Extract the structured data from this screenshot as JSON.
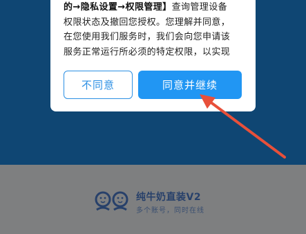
{
  "dialog": {
    "line1_bold": "的→隐私设置→权限管理】",
    "line1_rest": "查询管理设备",
    "line2": "权限状态及撤回您授权。您理解并同意，",
    "line3": "在您使用我们服务时，我们会向您申请该",
    "line4": "服务正常运行所必须的特定权限，以实现",
    "decline_label": "不同意",
    "agree_label": "同意并继续"
  },
  "brand": {
    "title": "纯牛奶直装V2",
    "subtitle": "多个账号，同时在线"
  },
  "colors": {
    "overlay_top": "#0f4673",
    "overlay_bottom": "#7e7f80",
    "accent": "#2196f3",
    "arrow": "#e8503a"
  },
  "icons": {
    "annotation": "red-arrow-icon",
    "logo": "double-face-logo-icon"
  }
}
